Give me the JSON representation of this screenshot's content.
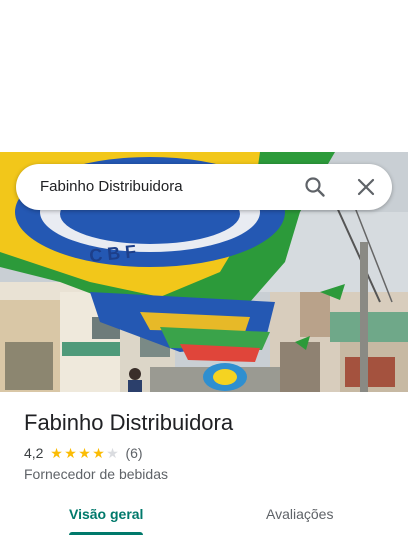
{
  "search": {
    "query": "Fabinho Distribuidora",
    "search_icon": "search-icon",
    "close_icon": "close-icon"
  },
  "place": {
    "name": "Fabinho Distribuidora",
    "rating": "4,2",
    "rating_value": 4.2,
    "stars_max": 5,
    "review_count": "(6)",
    "category": "Fornecedor de bebidas"
  },
  "tabs": [
    {
      "label": "Visão geral",
      "active": true
    },
    {
      "label": "Avaliações",
      "active": false
    }
  ],
  "colors": {
    "accent": "#00796b",
    "star": "#fbbc04",
    "star_empty": "#dadce0"
  }
}
